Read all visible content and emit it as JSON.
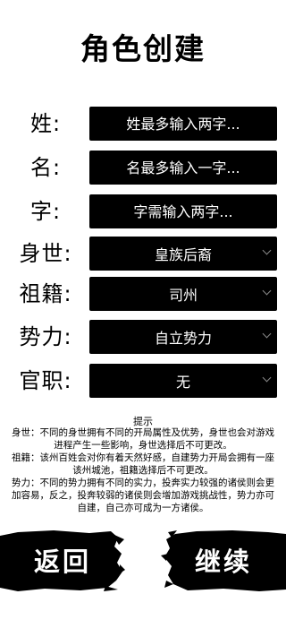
{
  "title": "角色创建",
  "form": {
    "surname": {
      "label": "姓:",
      "placeholder": "姓最多输入两字..."
    },
    "given_name": {
      "label": "名:",
      "placeholder": "名最多输入一字..."
    },
    "courtesy": {
      "label": "字:",
      "placeholder": "字需输入两字..."
    },
    "background": {
      "label": "身世:",
      "value": "皇族后裔"
    },
    "origin": {
      "label": "祖籍:",
      "value": "司州"
    },
    "faction": {
      "label": "势力:",
      "value": "自立势力"
    },
    "office": {
      "label": "官职:",
      "value": "无"
    }
  },
  "hint": {
    "title": "提示",
    "background": "身世：不同的身世拥有不同的开局属性及优势，身世也会对游戏进程产生一些影响，身世选择后不可更改。",
    "origin": "祖籍：该州百姓会对你有着天然好感，自建势力开局会拥有一座该州城池，祖籍选择后不可更改。",
    "faction": "势力：不同的势力拥有不同的实力，投奔实力较强的诸侯则会更加容易，反之，投奔较弱的诸侯则会增加游戏挑战性，势力亦可自建，自己亦可成为一方诸侯。"
  },
  "buttons": {
    "back": "返回",
    "continue": "继续"
  },
  "colors": {
    "background": "#ffffff",
    "field": "#000000",
    "text_on_field": "#ffffff"
  }
}
